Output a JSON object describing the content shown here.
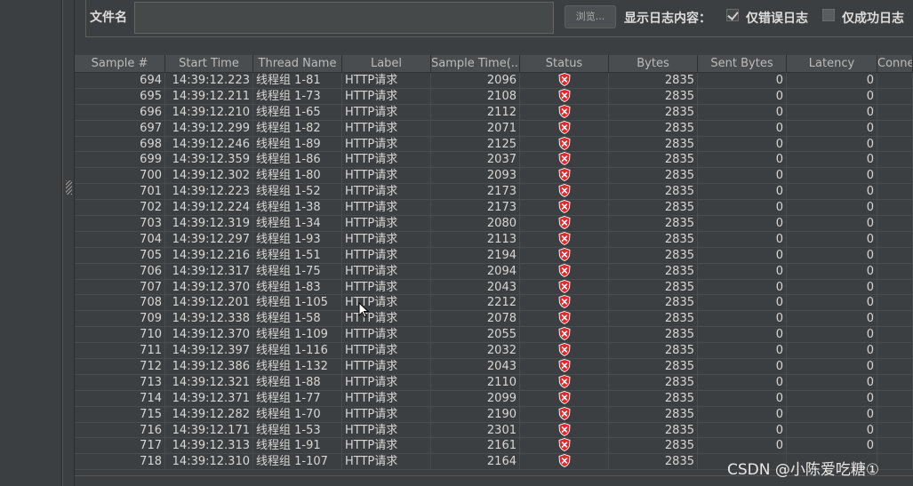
{
  "file_panel": {
    "filename_label": "文件名",
    "filename_value": "",
    "browse_label": "浏览...",
    "log_content_label": "显示日志内容：",
    "errors_only_label": "仅错误日志",
    "errors_only_checked": true,
    "success_only_label": "仅成功日志",
    "success_only_checked": false
  },
  "table": {
    "columns": [
      "Sample #",
      "Start Time",
      "Thread Name",
      "Label",
      "Sample Time(...",
      "Status",
      "Bytes",
      "Sent Bytes",
      "Latency",
      "Conne"
    ],
    "status_icon": "error-shield-icon",
    "status_color": "#e0282d",
    "rows": [
      [
        "694",
        "14:39:12.223",
        "线程组 1-81",
        "HTTP请求",
        "2096",
        "error",
        "2835",
        "0",
        "0"
      ],
      [
        "695",
        "14:39:12.211",
        "线程组 1-73",
        "HTTP请求",
        "2108",
        "error",
        "2835",
        "0",
        "0"
      ],
      [
        "696",
        "14:39:12.210",
        "线程组 1-65",
        "HTTP请求",
        "2112",
        "error",
        "2835",
        "0",
        "0"
      ],
      [
        "697",
        "14:39:12.299",
        "线程组 1-82",
        "HTTP请求",
        "2071",
        "error",
        "2835",
        "0",
        "0"
      ],
      [
        "698",
        "14:39:12.246",
        "线程组 1-89",
        "HTTP请求",
        "2125",
        "error",
        "2835",
        "0",
        "0"
      ],
      [
        "699",
        "14:39:12.359",
        "线程组 1-86",
        "HTTP请求",
        "2037",
        "error",
        "2835",
        "0",
        "0"
      ],
      [
        "700",
        "14:39:12.302",
        "线程组 1-80",
        "HTTP请求",
        "2093",
        "error",
        "2835",
        "0",
        "0"
      ],
      [
        "701",
        "14:39:12.223",
        "线程组 1-52",
        "HTTP请求",
        "2173",
        "error",
        "2835",
        "0",
        "0"
      ],
      [
        "702",
        "14:39:12.224",
        "线程组 1-38",
        "HTTP请求",
        "2173",
        "error",
        "2835",
        "0",
        "0"
      ],
      [
        "703",
        "14:39:12.319",
        "线程组 1-34",
        "HTTP请求",
        "2080",
        "error",
        "2835",
        "0",
        "0"
      ],
      [
        "704",
        "14:39:12.297",
        "线程组 1-93",
        "HTTP请求",
        "2113",
        "error",
        "2835",
        "0",
        "0"
      ],
      [
        "705",
        "14:39:12.216",
        "线程组 1-51",
        "HTTP请求",
        "2194",
        "error",
        "2835",
        "0",
        "0"
      ],
      [
        "706",
        "14:39:12.317",
        "线程组 1-75",
        "HTTP请求",
        "2094",
        "error",
        "2835",
        "0",
        "0"
      ],
      [
        "707",
        "14:39:12.370",
        "线程组 1-83",
        "HTTP请求",
        "2043",
        "error",
        "2835",
        "0",
        "0"
      ],
      [
        "708",
        "14:39:12.201",
        "线程组 1-105",
        "HTTP请求",
        "2212",
        "error",
        "2835",
        "0",
        "0"
      ],
      [
        "709",
        "14:39:12.338",
        "线程组 1-58",
        "HTTP请求",
        "2078",
        "error",
        "2835",
        "0",
        "0"
      ],
      [
        "710",
        "14:39:12.370",
        "线程组 1-109",
        "HTTP请求",
        "2055",
        "error",
        "2835",
        "0",
        "0"
      ],
      [
        "711",
        "14:39:12.397",
        "线程组 1-116",
        "HTTP请求",
        "2032",
        "error",
        "2835",
        "0",
        "0"
      ],
      [
        "712",
        "14:39:12.386",
        "线程组 1-132",
        "HTTP请求",
        "2043",
        "error",
        "2835",
        "0",
        "0"
      ],
      [
        "713",
        "14:39:12.321",
        "线程组 1-88",
        "HTTP请求",
        "2110",
        "error",
        "2835",
        "0",
        "0"
      ],
      [
        "714",
        "14:39:12.371",
        "线程组 1-77",
        "HTTP请求",
        "2099",
        "error",
        "2835",
        "0",
        "0"
      ],
      [
        "715",
        "14:39:12.282",
        "线程组 1-70",
        "HTTP请求",
        "2190",
        "error",
        "2835",
        "0",
        "0"
      ],
      [
        "716",
        "14:39:12.171",
        "线程组 1-53",
        "HTTP请求",
        "2301",
        "error",
        "2835",
        "0",
        "0"
      ],
      [
        "717",
        "14:39:12.313",
        "线程组 1-91",
        "HTTP请求",
        "2161",
        "error",
        "2835",
        "0",
        "0"
      ],
      [
        "718",
        "14:39:12.310",
        "线程组 1-107",
        "HTTP请求",
        "2164",
        "error",
        "2835",
        "",
        ""
      ]
    ]
  },
  "watermark": "CSDN @小陈爱吃糖①"
}
